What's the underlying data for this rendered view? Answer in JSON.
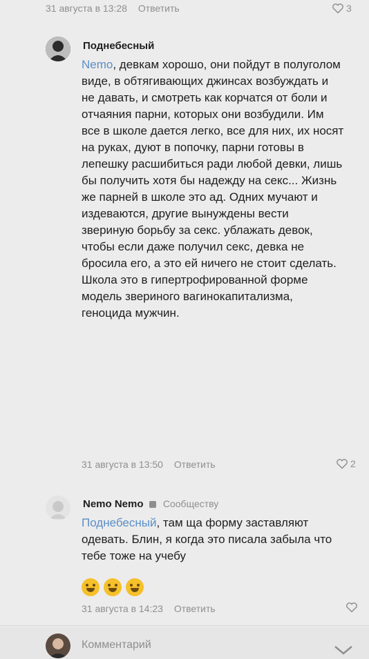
{
  "top_meta": {
    "date": "31 августа в 13:28",
    "reply": "Ответить",
    "likes": "3"
  },
  "comments": [
    {
      "author": "Поднебесный",
      "mention": "Nemo",
      "text": ", девкам хорошо, они пойдут в полуголом виде, в обтягивающих джинсах возбуждать и не давать, и смотреть как корчатся от боли и отчаяния парни, которых они возбудили. Им все в школе дается легко, все для них, их носят на руках, дуют в попочку, парни готовы в лепешку расшибиться ради любой девки, лишь бы получить хотя бы надежду на секс... Жизнь же парней в школе это ад. Одних мучают и издеваются, другие вынуждены вести звериную борьбу за секс. ублажать девок, чтобы если даже получил секс, девка не бросила его, а это ей ничего не стоит сделать. Школа это в гипертрофированной форме модель звериного вагинокапитализма, геноцида мужчин.",
      "date": "31 августа в 13:50",
      "reply": "Ответить",
      "likes": "2"
    },
    {
      "author": "Nemo Nemo",
      "author_badge": "Сообществу",
      "mention": "Поднебесный",
      "text": ", там ща форму заставляют одевать. Блин, я когда это писала забыла что тебе тоже на учебу",
      "emojis": [
        "grin-emoji",
        "grin-emoji",
        "sweat-smile-emoji"
      ],
      "date": "31 августа в 14:23",
      "reply": "Ответить",
      "likes": ""
    }
  ],
  "compose": {
    "placeholder": "Комментарий"
  },
  "icons": {
    "like": "heart-icon",
    "chevron": "chevron-down-icon"
  },
  "colors": {
    "mention": "#5a8ec7",
    "meta": "#8e8e8e",
    "text": "#1e1e1e",
    "background": "#ececec"
  }
}
